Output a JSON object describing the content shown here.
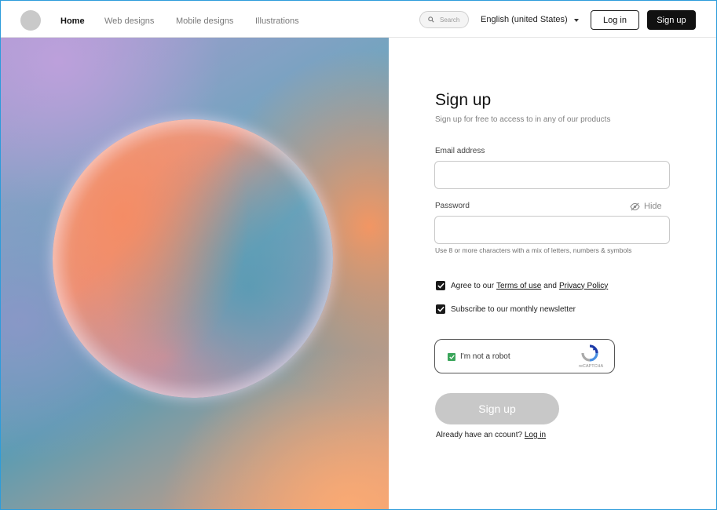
{
  "nav": {
    "links": [
      "Home",
      "Web designs",
      "Mobile designs",
      "Illustrations"
    ],
    "search_placeholder": "Search",
    "language": "English (united States)",
    "login_label": "Log in",
    "signup_label": "Sign up"
  },
  "form": {
    "title": "Sign up",
    "subtitle": "Sign up for free to access to in any of our products",
    "email_label": "Email address",
    "email_value": "",
    "password_label": "Password",
    "password_value": "",
    "hide_label": "Hide",
    "password_hint": "Use 8 or more characters with a mix of letters, numbers & symbols",
    "agree_prefix": "Agree to our",
    "terms_link": "Terms of use",
    "agree_and": "and",
    "privacy_link": "Privacy Policy",
    "agree_checked": true,
    "newsletter_label": "Subscribe to our monthly newsletter",
    "newsletter_checked": true,
    "captcha_label": "I'm not a robot",
    "captcha_brand": "reCAPTCHA",
    "captcha_checked": true,
    "submit_label": "Sign up",
    "already_text": "Already have an ccount?",
    "login_link": "Log in"
  },
  "colors": {
    "primary": "#111111",
    "submit_disabled": "#c8c8c8",
    "captcha_check": "#3aa55a",
    "frame_border": "#2d9cdb"
  },
  "icons": [
    "search-icon",
    "eye-off-icon",
    "checkmark-icon",
    "recaptcha-icon",
    "chevron-down-icon"
  ]
}
